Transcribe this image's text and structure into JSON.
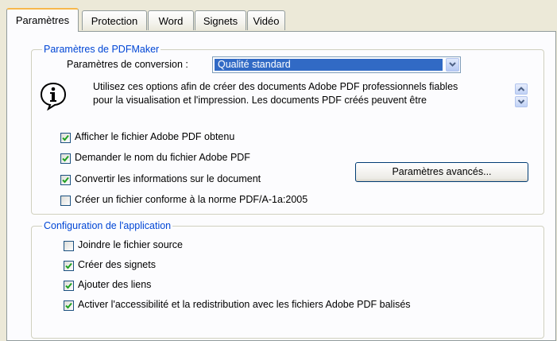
{
  "tabs": [
    {
      "label": "Paramètres",
      "active": true
    },
    {
      "label": "Protection",
      "active": false
    },
    {
      "label": "Word",
      "active": false
    },
    {
      "label": "Signets",
      "active": false
    },
    {
      "label": "Vidéo",
      "active": false
    }
  ],
  "pdfmaker": {
    "legend": "Paramètres de PDFMaker",
    "conversion_label": "Paramètres de conversion :",
    "conversion_value": "Qualité standard",
    "info_line1": "Utilisez ces options afin de créer des documents Adobe PDF professionnels fiables",
    "info_line2": "pour la visualisation et l'impression. Les documents PDF créés peuvent être",
    "options": [
      {
        "label": "Afficher le fichier Adobe PDF obtenu",
        "checked": true
      },
      {
        "label": "Demander le nom du fichier Adobe PDF",
        "checked": true
      },
      {
        "label": "Convertir les informations sur le document",
        "checked": true
      },
      {
        "label": "Créer un fichier conforme à la norme PDF/A-1a:2005",
        "checked": false
      }
    ],
    "advanced_button": "Paramètres avancés..."
  },
  "app_config": {
    "legend": "Configuration de l'application",
    "options": [
      {
        "label": "Joindre le fichier source",
        "checked": false
      },
      {
        "label": "Créer des signets",
        "checked": true
      },
      {
        "label": "Ajouter des liens",
        "checked": true
      },
      {
        "label": "Activer l'accessibilité et la redistribution avec les fichiers Adobe PDF balisés",
        "checked": true
      }
    ]
  },
  "icons": {
    "info": "info-icon",
    "dropdown": "chevron-down-icon",
    "scroll_up": "scroll-up-icon",
    "scroll_down": "scroll-down-icon",
    "check": "checkmark-icon"
  },
  "colors": {
    "accent_tab": "#f7b84b",
    "group_legend": "#0046d5",
    "selection": "#316ac5",
    "checkmark": "#21a121"
  }
}
